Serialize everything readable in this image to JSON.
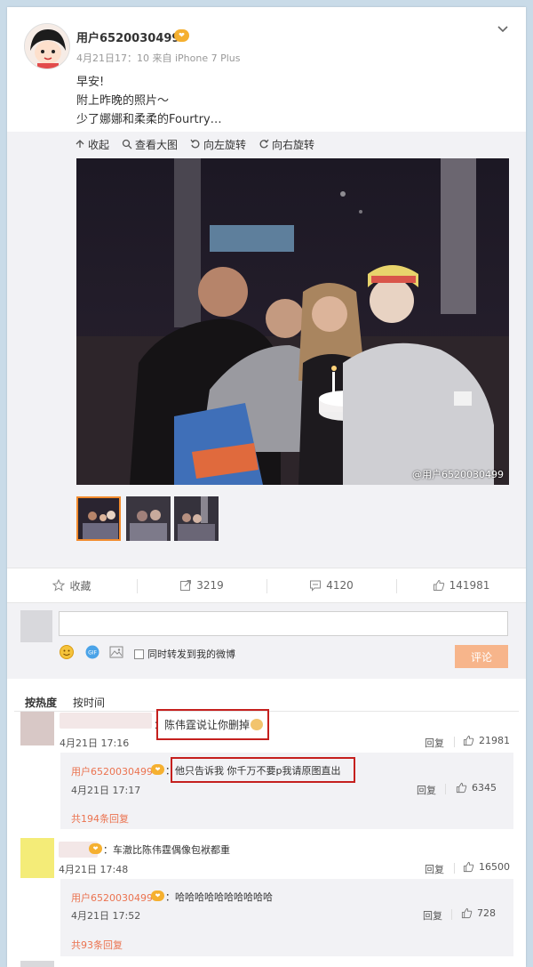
{
  "post": {
    "username": "用户6520030499",
    "vip_badge": "❤",
    "meta": "4月21日17：10 来自 iPhone 7 Plus",
    "lines": [
      "早安!",
      "附上昨晚的照片～",
      "少了娜娜和柔柔的Fourtry…"
    ]
  },
  "media": {
    "tools": [
      {
        "icon": "up-arrow-icon",
        "label": "收起"
      },
      {
        "icon": "magnifier-icon",
        "label": "查看大图"
      },
      {
        "icon": "rotate-left-icon",
        "label": "向左旋转"
      },
      {
        "icon": "rotate-right-icon",
        "label": "向右旋转"
      }
    ],
    "watermark": "@用户6520030499"
  },
  "actions": {
    "favorite": "收藏",
    "repost": "3219",
    "comment": "4120",
    "like": "141981"
  },
  "composer": {
    "placeholder": "",
    "repost_label": "同时转发到我的微博",
    "submit": "评论"
  },
  "sort": {
    "hot": "按热度",
    "time": "按时间"
  },
  "comments": [
    {
      "text": "：陈伟霆说让你删掉",
      "time": "4月21日 17:16",
      "reply": "回复",
      "likes": "21981",
      "sub": {
        "name": "用户6520030499",
        "text": "：他只告诉我 你千万不要p我请原图直出",
        "time": "4月21日 17:17",
        "reply": "回复",
        "likes": "6345"
      },
      "more": "共194条回复"
    },
    {
      "text": "：车澈比陈伟霆偶像包袱都重",
      "time": "4月21日 17:48",
      "reply": "回复",
      "likes": "16500",
      "sub": {
        "name": "用户6520030499",
        "text": "：哈哈哈哈哈哈哈哈哈哈",
        "time": "4月21日 17:52",
        "reply": "回复",
        "likes": "728"
      },
      "more": "共93条回复"
    }
  ],
  "colors": {
    "accent": "#eb7350",
    "highlight": "#c5201e",
    "submit": "#f7b58b",
    "page_bg": "#c9dbe8"
  }
}
